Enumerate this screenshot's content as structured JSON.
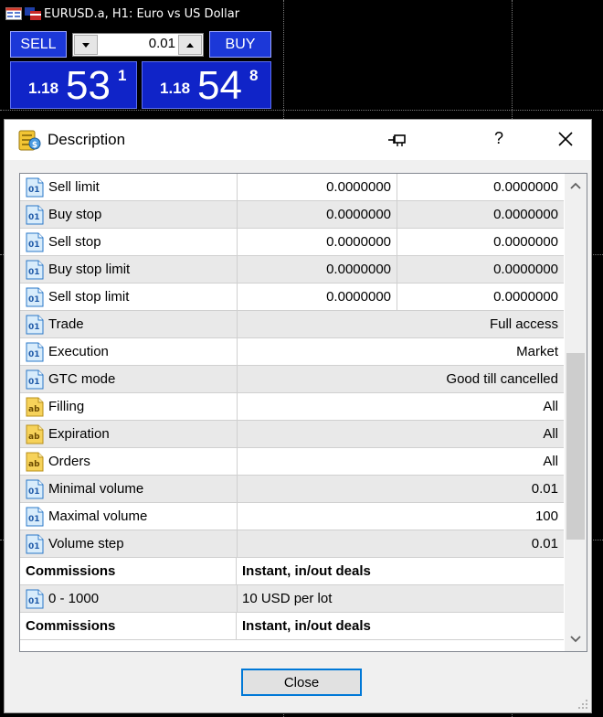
{
  "chart": {
    "title": "EURUSD.a, H1:  Euro vs US Dollar",
    "colors": {
      "background": "#000000",
      "text": "#ffffff",
      "panel_blue": "#1c38d8"
    }
  },
  "trade_panel": {
    "sell_label": "SELL",
    "buy_label": "BUY",
    "volume": "0.01",
    "bid": {
      "big": "1.18",
      "pips": "53",
      "point": "1"
    },
    "ask": {
      "big": "1.18",
      "pips": "54",
      "point": "8"
    }
  },
  "dialog": {
    "title": "Description",
    "help_label": "?",
    "close_button": "Close",
    "rows": [
      {
        "icon": "01",
        "label": "Sell limit",
        "v1": "0.0000000",
        "v2": "0.0000000"
      },
      {
        "icon": "01",
        "label": "Buy stop",
        "v1": "0.0000000",
        "v2": "0.0000000"
      },
      {
        "icon": "01",
        "label": "Sell stop",
        "v1": "0.0000000",
        "v2": "0.0000000"
      },
      {
        "icon": "01",
        "label": "Buy stop limit",
        "v1": "0.0000000",
        "v2": "0.0000000"
      },
      {
        "icon": "01",
        "label": "Sell stop limit",
        "v1": "0.0000000",
        "v2": "0.0000000"
      },
      {
        "icon": "01",
        "label": "Trade",
        "value": "Full access"
      },
      {
        "icon": "01",
        "label": "Execution",
        "value": "Market"
      },
      {
        "icon": "01",
        "label": "GTC mode",
        "value": "Good till cancelled"
      },
      {
        "icon": "ab",
        "label": "Filling",
        "value": "All"
      },
      {
        "icon": "ab",
        "label": "Expiration",
        "value": "All"
      },
      {
        "icon": "ab",
        "label": "Orders",
        "value": "All"
      },
      {
        "icon": "01",
        "label": "Minimal volume",
        "value": "0.01"
      },
      {
        "icon": "01",
        "label": "Maximal volume",
        "value": "100"
      },
      {
        "icon": "01",
        "label": "Volume step",
        "value": "0.01"
      },
      {
        "header": true,
        "label": "Commissions",
        "value": "Instant, in/out deals"
      },
      {
        "icon": "01",
        "label": "0 - 1000",
        "value": "10 USD per lot",
        "left": true
      },
      {
        "header": true,
        "label": "Commissions",
        "value": "Instant, in/out deals"
      }
    ]
  }
}
